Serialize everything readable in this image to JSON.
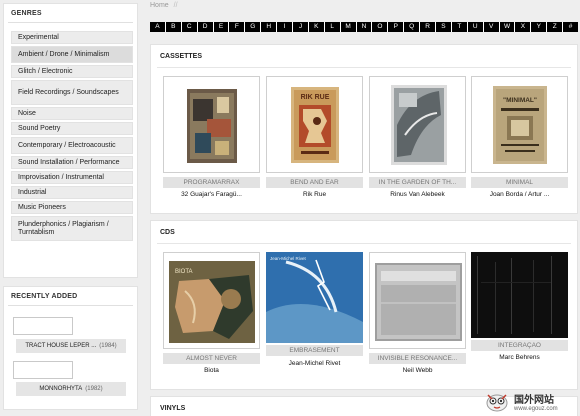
{
  "sidebar": {
    "genres_title": "GENRES",
    "genres": [
      {
        "label": "Experimental",
        "active": false
      },
      {
        "label": "Ambient / Drone / Minimalism",
        "active": true
      },
      {
        "label": "Glitch / Electronic",
        "active": false
      },
      {
        "label": "Field Recordings / Soundscapes",
        "active": false
      },
      {
        "label": "Noise",
        "active": false
      },
      {
        "label": "Sound Poetry",
        "active": false
      },
      {
        "label": "Contemporary / Electroacoustic",
        "active": false
      },
      {
        "label": "Sound Installation / Performance",
        "active": false
      },
      {
        "label": "Improvisation / Instrumental",
        "active": false
      },
      {
        "label": "Industrial",
        "active": false
      },
      {
        "label": "Music Pioneers",
        "active": false
      },
      {
        "label": "Plunderphonics / Plagiarism / Turntablism",
        "active": false
      }
    ],
    "recent_title": "RECENTLY ADDED",
    "recent": [
      {
        "title": "TRACT HOUSE LEPER ...",
        "year": "(1984)"
      },
      {
        "title": "MONNORHYTA",
        "year": "(1982)"
      }
    ]
  },
  "breadcrumb": {
    "home": "Home",
    "sep": "//"
  },
  "alphabet": [
    "A",
    "B",
    "C",
    "D",
    "E",
    "F",
    "G",
    "H",
    "I",
    "J",
    "K",
    "L",
    "M",
    "N",
    "O",
    "P",
    "Q",
    "R",
    "S",
    "T",
    "U",
    "V",
    "W",
    "X",
    "Y",
    "Z",
    "#"
  ],
  "sections": {
    "cassettes": {
      "title": "CASSETTES",
      "items": [
        {
          "category": "PROGRAMARRAX",
          "artist": "32 Guajar's Faragü..."
        },
        {
          "category": "BEND AND EAR",
          "artist": "Rik Rue"
        },
        {
          "category": "IN THE GARDEN OF TH...",
          "artist": "Rinus Van Alebeek"
        },
        {
          "category": "MINIMAL",
          "artist": "Joan Borda / Artur ..."
        }
      ]
    },
    "cds": {
      "title": "CDS",
      "items": [
        {
          "category": "ALMOST NEVER",
          "artist": "Biota"
        },
        {
          "category": "EMBRASEMENT",
          "artist": "Jean-Michel Rivet"
        },
        {
          "category": "INVISIBLE RESONANCE...",
          "artist": "Neil Webb"
        },
        {
          "category": "INTEGRAÇAO",
          "artist": "Marc Behrens"
        }
      ]
    },
    "vinyls": {
      "title": "VINYLS"
    }
  },
  "covers": {
    "cassette_2_text": "RIK RUE",
    "cassette_4_text": "\"MINIMAL\"",
    "cd_1_text": "BIOTA",
    "cd_2_text": "Jean-Michel Rivet"
  },
  "watermark": {
    "cn": "国外网站",
    "url": "www.egouz.com"
  },
  "colors": {
    "alphabet_bg": "#000000",
    "accent_label_bg": "#e2e2e2"
  }
}
